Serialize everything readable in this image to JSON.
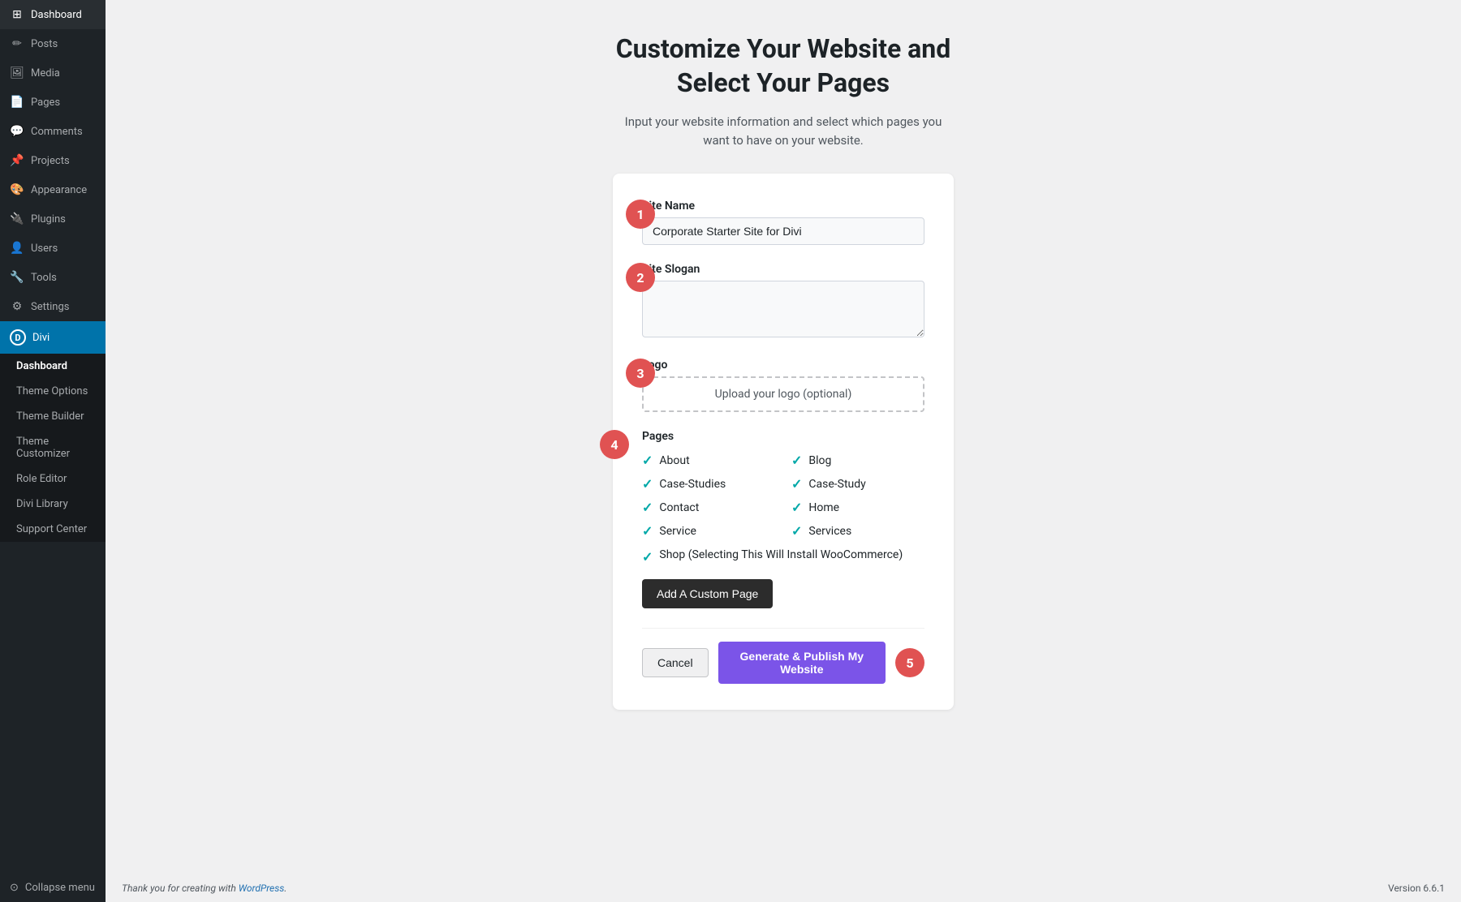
{
  "sidebar": {
    "items": [
      {
        "id": "dashboard",
        "label": "Dashboard",
        "icon": "⊞"
      },
      {
        "id": "posts",
        "label": "Posts",
        "icon": "📝"
      },
      {
        "id": "media",
        "label": "Media",
        "icon": "🖼"
      },
      {
        "id": "pages",
        "label": "Pages",
        "icon": "📄"
      },
      {
        "id": "comments",
        "label": "Comments",
        "icon": "💬"
      },
      {
        "id": "projects",
        "label": "Projects",
        "icon": "📌"
      },
      {
        "id": "appearance",
        "label": "Appearance",
        "icon": "🎨"
      },
      {
        "id": "plugins",
        "label": "Plugins",
        "icon": "🔌"
      },
      {
        "id": "users",
        "label": "Users",
        "icon": "👤"
      },
      {
        "id": "tools",
        "label": "Tools",
        "icon": "🔧"
      },
      {
        "id": "settings",
        "label": "Settings",
        "icon": "⚙"
      }
    ],
    "divi": {
      "label": "Divi",
      "submenu": [
        {
          "id": "dashboard",
          "label": "Dashboard",
          "active": true
        },
        {
          "id": "theme-options",
          "label": "Theme Options"
        },
        {
          "id": "theme-builder",
          "label": "Theme Builder"
        },
        {
          "id": "theme-customizer",
          "label": "Theme Customizer"
        },
        {
          "id": "role-editor",
          "label": "Role Editor"
        },
        {
          "id": "divi-library",
          "label": "Divi Library"
        },
        {
          "id": "support-center",
          "label": "Support Center"
        }
      ]
    },
    "collapse_label": "Collapse menu"
  },
  "main": {
    "title": "Customize Your Website and\nSelect Your Pages",
    "subtitle": "Input your website information and select which pages you want to have on your website.",
    "steps": {
      "step1": "1",
      "step2": "2",
      "step3": "3",
      "step4": "4",
      "step5": "5"
    },
    "fields": {
      "site_name_label": "Site Name",
      "site_name_value": "Corporate Starter Site for Divi",
      "site_name_placeholder": "Corporate Starter Site for Divi",
      "site_slogan_label": "Site Slogan",
      "site_slogan_placeholder": "",
      "logo_label": "Logo",
      "logo_upload_text": "Upload your logo (optional)"
    },
    "pages": {
      "label": "Pages",
      "items": [
        {
          "id": "about",
          "label": "About",
          "checked": true
        },
        {
          "id": "blog",
          "label": "Blog",
          "checked": true
        },
        {
          "id": "case-studies",
          "label": "Case-Studies",
          "checked": true
        },
        {
          "id": "case-study",
          "label": "Case-Study",
          "checked": true
        },
        {
          "id": "contact",
          "label": "Contact",
          "checked": true
        },
        {
          "id": "home",
          "label": "Home",
          "checked": true
        },
        {
          "id": "service",
          "label": "Service",
          "checked": true
        },
        {
          "id": "services",
          "label": "Services",
          "checked": true
        }
      ],
      "shop": {
        "id": "shop",
        "label": "Shop (Selecting This Will Install WooCommerce)",
        "checked": true
      }
    },
    "add_custom_label": "Add A Custom Page",
    "cancel_label": "Cancel",
    "generate_label": "Generate & Publish My Website"
  },
  "footer": {
    "text_before_link": "Thank you for creating with ",
    "link_text": "WordPress",
    "text_after_link": ".",
    "version": "Version 6.6.1"
  }
}
